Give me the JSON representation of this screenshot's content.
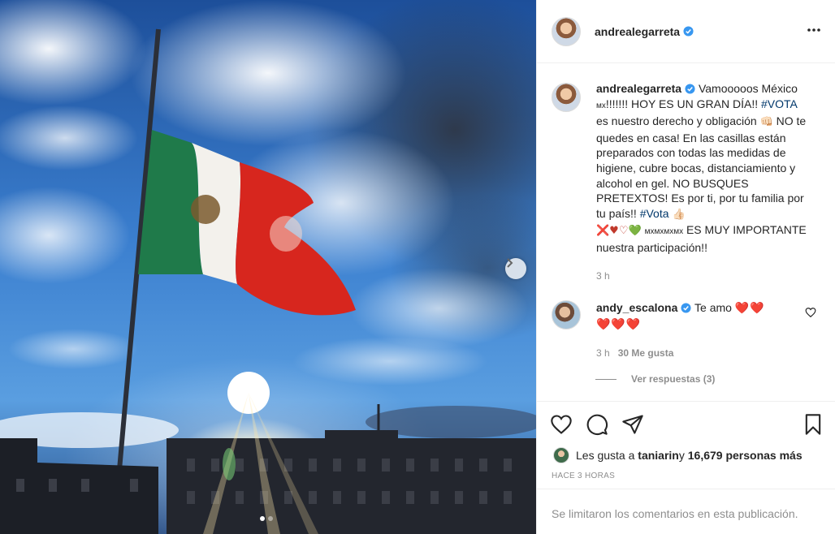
{
  "post": {
    "username": "andrealegarreta",
    "caption": {
      "text_before": " Vamooooos México ",
      "flag_small": "мх",
      "text_mid": "!!!!!!! HOY ES UN GRAN DÍA!! ",
      "hashtag_vota": "#VOTA",
      "text_after": " es nuestro derecho y obligación ",
      "emoji_fist": "👊🏻",
      "text_body": " NO te quedes en casa! En las casillas están preparados con todas las medidas de higiene, cubre bocas, distanciamiento y alcohol en gel. NO BUSQUES PRETEXTOS! Es por ti, por tu familia por tu país!! ",
      "hashtag_vota2": "#Vota",
      "emoji_thumb": " 👍🏻",
      "emoji_hearts": "❌♥♡💚",
      "mx_small": "мхмхмхмх",
      "text_end": " ES MUY IMPORTANTE nuestra participación!!"
    },
    "caption_time": "3 h"
  },
  "comment": {
    "username": "andy_escalona",
    "text": " Te amo ",
    "hearts_inline": "❤️❤️",
    "hearts_line2": "❤️❤️❤️",
    "time": "3 h",
    "likes": "30 Me gusta",
    "replies_label": "Ver respuestas (3)"
  },
  "likes": {
    "prefix": "Les gusta a ",
    "user": "taniarin",
    "middle": " y ",
    "count": "16,679 personas más"
  },
  "age_label": "HACE 3 HORAS",
  "comments_limited": "Se limitaron los comentarios en esta publicación.",
  "carousel": {
    "current": 1,
    "total": 2
  },
  "icons": {
    "more": "more-options-icon",
    "verified": "verified-badge-icon",
    "like": "heart-outline-icon",
    "comment": "comment-bubble-icon",
    "share": "paper-plane-icon",
    "save": "bookmark-icon",
    "next": "chevron-right-icon"
  },
  "colors": {
    "verified": "#3897f0",
    "hashtag": "#00376b",
    "muted": "#8e8e8e",
    "heart": "#e0245e",
    "flag_green": "#1f7a4a",
    "flag_red": "#d7261e"
  }
}
